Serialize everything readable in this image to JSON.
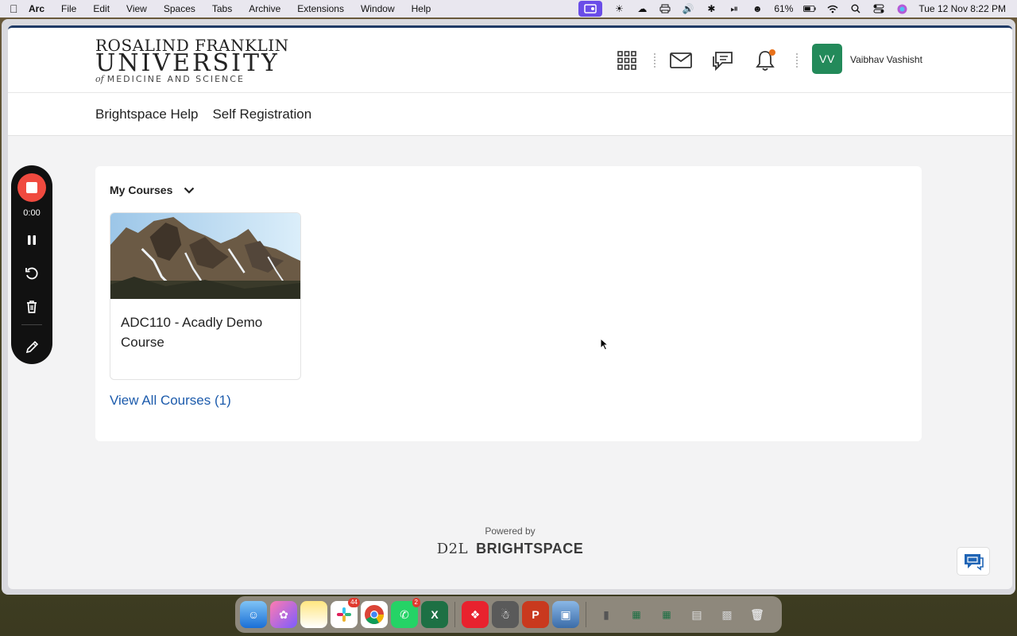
{
  "menubar": {
    "app": "Arc",
    "items": [
      "File",
      "Edit",
      "View",
      "Spaces",
      "Tabs",
      "Archive",
      "Extensions",
      "Window",
      "Help"
    ],
    "battery": "61%",
    "datetime": "Tue 12 Nov  8:22 PM"
  },
  "header": {
    "logo_line1": "ROSALIND FRANKLIN",
    "logo_line2": "UNIVERSITY",
    "logo_line3_of": "of",
    "logo_line3": "MEDICINE AND SCIENCE",
    "avatar_initials": "VV",
    "user_name": "Vaibhav Vashisht"
  },
  "nav": {
    "links": [
      "Brightspace Help",
      "Self Registration"
    ]
  },
  "courses": {
    "title": "My Courses",
    "card_title": "ADC110 - Acadly Demo Course",
    "view_all": "View All Courses (1)"
  },
  "recorder": {
    "time": "0:00"
  },
  "footer": {
    "powered_by": "Powered by",
    "brand_d2l": "D2L",
    "brand_name": "BRIGHTSPACE"
  },
  "dock": {
    "slack_badge": "44",
    "whatsapp_badge": "2"
  },
  "colors": {
    "accent_navy": "#1f3a66",
    "avatar_green": "#238a5a",
    "link_blue": "#1c5bac",
    "record_red": "#f04a3f"
  }
}
